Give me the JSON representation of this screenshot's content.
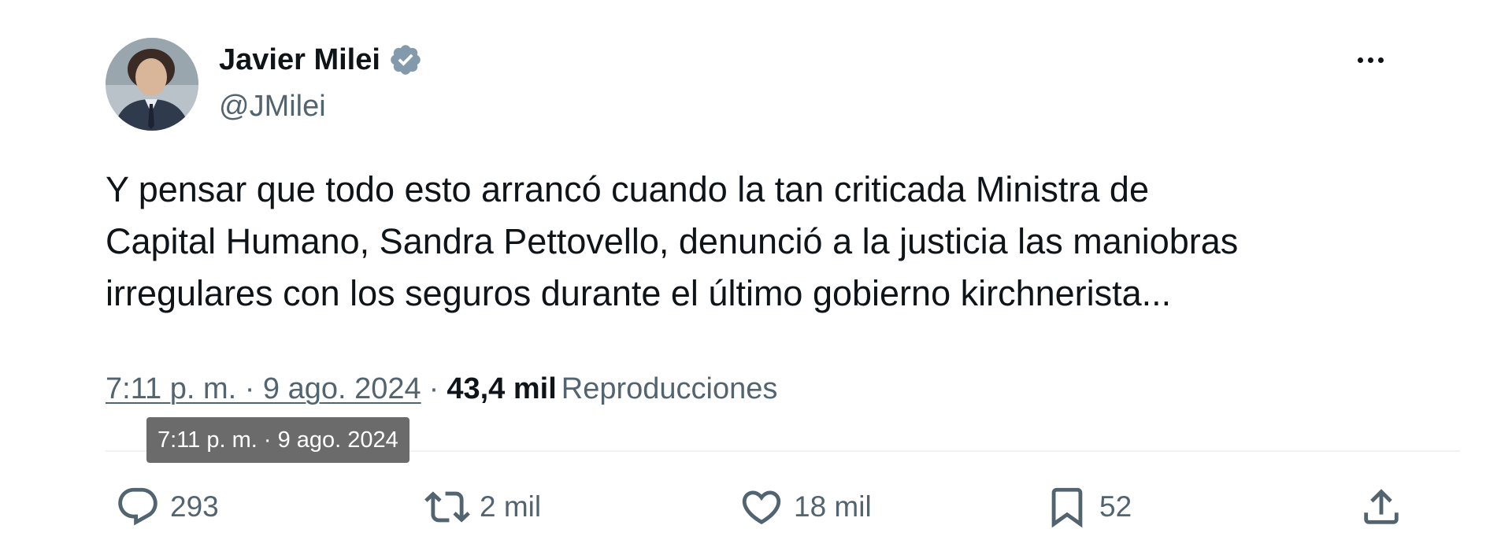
{
  "author": {
    "display_name": "Javier Milei",
    "handle": "@JMilei",
    "verified": true,
    "verified_badge_color": "#829aab"
  },
  "more_icon": "more-horizontal-icon",
  "tweet": {
    "text": "Y pensar que todo esto arrancó cuando la tan criticada Ministra de\nCapital Humano, Sandra Pettovello, denunció a la justicia las maniobras\nirregulares con los seguros durante el último gobierno kirchnerista..."
  },
  "meta": {
    "timestamp": "7:11 p. m. · 9 ago. 2024",
    "separator": "·",
    "views_count": "43,4 mil",
    "views_label": "Reproducciones"
  },
  "tooltip": {
    "text": "7:11 p. m. · 9 ago. 2024"
  },
  "actions": {
    "reply": {
      "icon": "reply-icon",
      "count": "293"
    },
    "retweet": {
      "icon": "retweet-icon",
      "count": "2 mil"
    },
    "like": {
      "icon": "heart-icon",
      "count": "18 mil"
    },
    "bookmark": {
      "icon": "bookmark-icon",
      "count": "52"
    },
    "share": {
      "icon": "share-icon"
    }
  },
  "colors": {
    "text_primary": "#0f1419",
    "text_secondary": "#536471",
    "divider": "#eff3f4",
    "tooltip_bg": "#6b6b6b"
  }
}
